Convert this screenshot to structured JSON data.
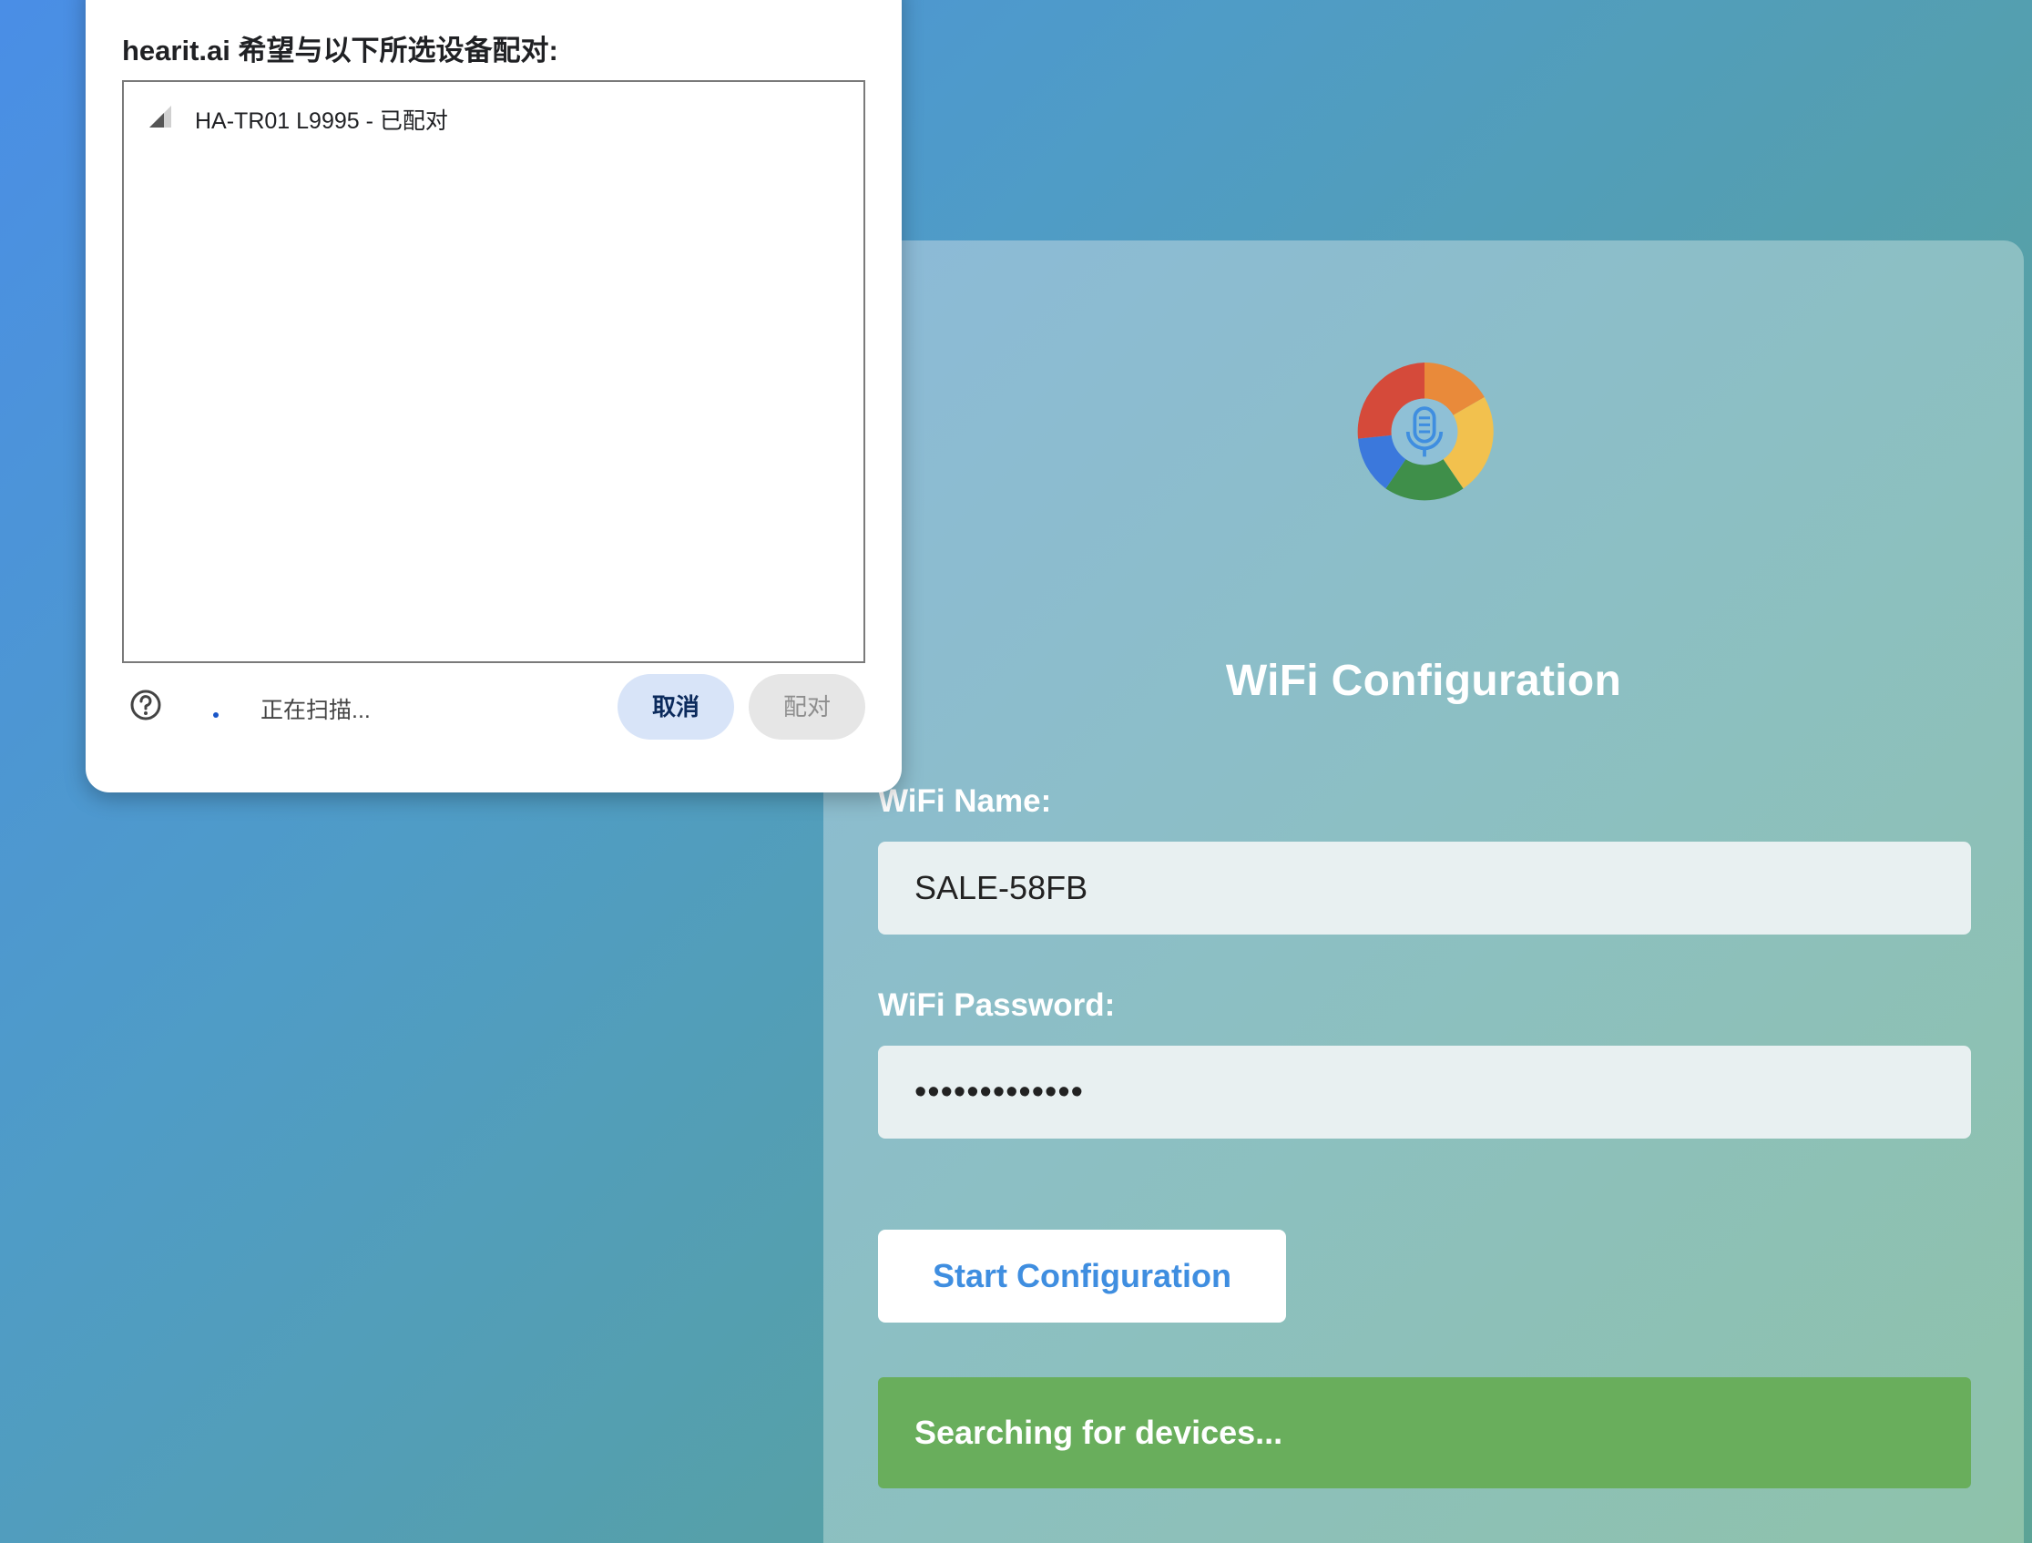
{
  "dialog": {
    "title": "hearit.ai 希望与以下所选设备配对:",
    "devices": [
      {
        "name": "HA-TR01 L9995 - 已配对"
      }
    ],
    "status_text": "正在扫描...",
    "cancel_label": "取消",
    "pair_label": "配对",
    "icons": [
      "signal-strength-icon",
      "help-icon",
      "loading-spinner-icon"
    ]
  },
  "card": {
    "logo_icon": "microphone-logo-icon",
    "title": "WiFi Configuration",
    "wifi_name_label": "WiFi Name:",
    "wifi_name_value": "SALE-58FB",
    "wifi_password_label": "WiFi Password:",
    "wifi_password_value": "•••••••••••••",
    "start_button_label": "Start Configuration",
    "status_message": "Searching for devices..."
  },
  "colors": {
    "accent_blue": "#3f8ee0",
    "status_green": "#69ae5c",
    "cancel_button_bg": "#d8e4f8"
  }
}
